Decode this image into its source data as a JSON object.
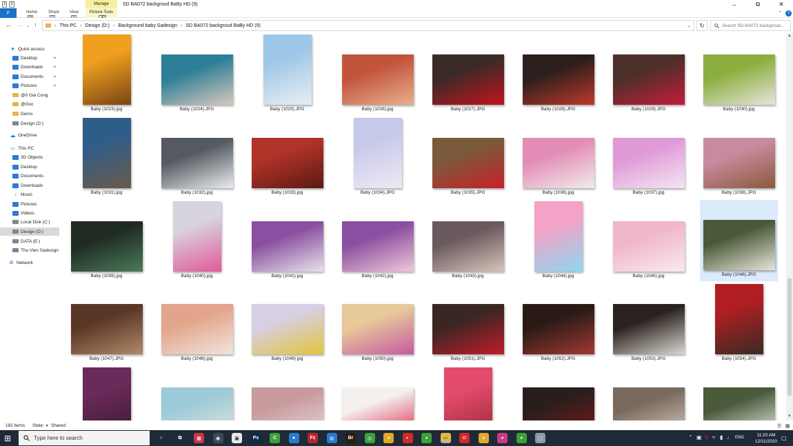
{
  "window": {
    "title": "SD BA072 backgroud BaBy HD (9)",
    "manage_tab": "Manage",
    "picture_tools": "Picture Tools",
    "file_tab": "F",
    "ribbon_tabs": [
      {
        "label": "Home",
        "key": "H"
      },
      {
        "label": "Share",
        "key": "S"
      },
      {
        "label": "View",
        "key": "V"
      },
      {
        "label": "Picture Tools",
        "key": "JP"
      }
    ],
    "qat_keys": [
      "1",
      "2"
    ]
  },
  "address": {
    "crumbs": [
      "This PC",
      "Design (D:)",
      "Background baby Sadesign",
      "SD BA072 backgroud BaBy HD (9)"
    ],
    "search_placeholder": "Search SD BA072 backgroud..."
  },
  "nav": {
    "items": [
      {
        "label": "Quick access",
        "icon": "star-icon"
      },
      {
        "label": "Desktop",
        "icon": "desktop-icon",
        "pinned": true
      },
      {
        "label": "Downloads",
        "icon": "download-icon",
        "pinned": true
      },
      {
        "label": "Documents",
        "icon": "documents-icon",
        "pinned": true
      },
      {
        "label": "Pictures",
        "icon": "pictures-icon",
        "pinned": true
      },
      {
        "label": "@0 Gia Cong",
        "icon": "folder-icon"
      },
      {
        "label": "@Goc",
        "icon": "folder-icon"
      },
      {
        "label": "Demo",
        "icon": "folder-icon"
      },
      {
        "label": "Design (D:)",
        "icon": "drive-icon"
      },
      {
        "label": "OneDrive",
        "icon": "cloud-icon"
      },
      {
        "label": "This PC",
        "icon": "computer-icon"
      },
      {
        "label": "3D Objects",
        "icon": "3d-objects-icon"
      },
      {
        "label": "Desktop",
        "icon": "desktop-icon"
      },
      {
        "label": "Documents",
        "icon": "documents-icon"
      },
      {
        "label": "Downloads",
        "icon": "download-icon"
      },
      {
        "label": "Music",
        "icon": "music-icon"
      },
      {
        "label": "Pictures",
        "icon": "pictures-icon"
      },
      {
        "label": "Videos",
        "icon": "videos-icon"
      },
      {
        "label": "Local Disk (C:)",
        "icon": "drive-icon"
      },
      {
        "label": "Design (D:)",
        "icon": "drive-icon",
        "selected": true
      },
      {
        "label": "DATA  (E:)",
        "icon": "drive-icon"
      },
      {
        "label": "Thu Vien Sadesign",
        "icon": "drive-icon"
      },
      {
        "label": "Network",
        "icon": "network-icon"
      }
    ]
  },
  "files": [
    {
      "name": "Baby (1023).jpg",
      "colors": [
        "#f0a01e",
        "#7a4414"
      ],
      "orient": "portrait"
    },
    {
      "name": "Baby (1024).JPG",
      "colors": [
        "#2c7f96",
        "#d9c8bb"
      ],
      "orient": "landscape"
    },
    {
      "name": "Baby (1025).JPG",
      "colors": [
        "#9ec7e7",
        "#e9eef2"
      ],
      "orient": "portrait"
    },
    {
      "name": "Baby (1026).jpg",
      "colors": [
        "#c3543c",
        "#e7b08e"
      ],
      "orient": "landscape"
    },
    {
      "name": "Baby (1027).JPG",
      "colors": [
        "#3a2a28",
        "#c2141c"
      ],
      "orient": "landscape"
    },
    {
      "name": "Baby (1028).JPG",
      "colors": [
        "#2a1f1c",
        "#c0382a"
      ],
      "orient": "landscape"
    },
    {
      "name": "Baby (1029).JPG",
      "colors": [
        "#4a3028",
        "#c51c3b"
      ],
      "orient": "landscape"
    },
    {
      "name": "Baby (1030).jpg",
      "colors": [
        "#8cae3e",
        "#e6e4dc"
      ],
      "orient": "landscape"
    },
    {
      "name": "Baby (1031).jpg",
      "colors": [
        "#2f5d8a",
        "#6a5a48"
      ],
      "orient": "portrait"
    },
    {
      "name": "Baby (1032).jpg",
      "colors": [
        "#555a60",
        "#e9ecf0"
      ],
      "orient": "landscape"
    },
    {
      "name": "Baby (1033).jpg",
      "colors": [
        "#b03228",
        "#5a1a14"
      ],
      "orient": "landscape"
    },
    {
      "name": "Baby (1034).JPG",
      "colors": [
        "#c7c9ea",
        "#efe9f4"
      ],
      "orient": "portrait"
    },
    {
      "name": "Baby (1035).JPG",
      "colors": [
        "#7a5a3a",
        "#c8202a"
      ],
      "orient": "landscape"
    },
    {
      "name": "Baby (1036).jpg",
      "colors": [
        "#e38cb6",
        "#f1ecea"
      ],
      "orient": "landscape"
    },
    {
      "name": "Baby (1037).jpg",
      "colors": [
        "#e09ad8",
        "#f4e6f2"
      ],
      "orient": "landscape"
    },
    {
      "name": "Baby (1038).JPG",
      "colors": [
        "#c98aa0",
        "#8a5a3a"
      ],
      "orient": "landscape"
    },
    {
      "name": "Baby (1039).jpg",
      "colors": [
        "#1e2a22",
        "#4c7a5a"
      ],
      "orient": "landscape"
    },
    {
      "name": "Baby (1040).jpg",
      "colors": [
        "#d8d4dd",
        "#e05a9a"
      ],
      "orient": "portrait"
    },
    {
      "name": "Baby (1041).jpg",
      "colors": [
        "#8a4fa0",
        "#e8e3ea"
      ],
      "orient": "landscape"
    },
    {
      "name": "Baby (1042).jpg",
      "colors": [
        "#8a4fa0",
        "#f0c8d8"
      ],
      "orient": "landscape"
    },
    {
      "name": "Baby (1043).jpg",
      "colors": [
        "#6a5a5e",
        "#d7c4bb"
      ],
      "orient": "landscape"
    },
    {
      "name": "Baby (1044).jpg",
      "colors": [
        "#f4a2c6",
        "#8fd6ef"
      ],
      "orient": "portrait"
    },
    {
      "name": "Baby (1045).jpg",
      "colors": [
        "#f0b6cc",
        "#fbe9ee"
      ],
      "orient": "landscape"
    },
    {
      "name": "Baby (1046).JPG",
      "colors": [
        "#4a5a38",
        "#e9e5da"
      ],
      "orient": "landscape",
      "selected": true
    },
    {
      "name": "Baby (1047).JPG",
      "colors": [
        "#5a3626",
        "#b08a6a"
      ],
      "orient": "landscape"
    },
    {
      "name": "Baby (1048).jpg",
      "colors": [
        "#e2a48a",
        "#f2e4dc"
      ],
      "orient": "landscape"
    },
    {
      "name": "Baby (1049).jpg",
      "colors": [
        "#d7cfe4",
        "#e3c43a"
      ],
      "orient": "landscape"
    },
    {
      "name": "Baby (1050).jpg",
      "colors": [
        "#e7c99a",
        "#c65aa0"
      ],
      "orient": "landscape"
    },
    {
      "name": "Baby (1051).JPG",
      "colors": [
        "#3a2622",
        "#c01c2a"
      ],
      "orient": "landscape"
    },
    {
      "name": "Baby (1052).JPG",
      "colors": [
        "#2a1a16",
        "#a03a32"
      ],
      "orient": "landscape"
    },
    {
      "name": "Baby (1053).JPG",
      "colors": [
        "#2a221e",
        "#dcd8d2"
      ],
      "orient": "landscape"
    },
    {
      "name": "Baby (1054).JPG",
      "colors": [
        "#b01e22",
        "#3a2a24"
      ],
      "orient": "portrait"
    },
    {
      "name": "",
      "colors": [
        "#6a2a5a",
        "#3a1a30"
      ],
      "orient": "portrait"
    },
    {
      "name": "",
      "colors": [
        "#9ccad6",
        "#e4e4e0"
      ],
      "orient": "landscape"
    },
    {
      "name": "",
      "colors": [
        "#c79a9e",
        "#e8d8d4"
      ],
      "orient": "landscape"
    },
    {
      "name": "",
      "colors": [
        "#f3f0ee",
        "#e02a4a"
      ],
      "orient": "landscape"
    },
    {
      "name": "",
      "colors": [
        "#e24b6a",
        "#9c2a3a"
      ],
      "orient": "portrait"
    },
    {
      "name": "",
      "colors": [
        "#2a1e1c",
        "#7a1a1a"
      ],
      "orient": "landscape"
    },
    {
      "name": "",
      "colors": [
        "#7a6a5e",
        "#d8ccc4"
      ],
      "orient": "landscape"
    },
    {
      "name": "",
      "colors": [
        "#4a5a3a",
        "#f0f0ee"
      ],
      "orient": "landscape"
    }
  ],
  "status": {
    "items_count": "182 items",
    "state_label": "State:",
    "state_value": "Shared"
  },
  "taskbar": {
    "search_placeholder": "Type here to search",
    "apps": [
      {
        "icon": "cortana-icon",
        "color": "#1f2a36",
        "glyph": "○"
      },
      {
        "icon": "task-view-icon",
        "color": "#1f2a36",
        "glyph": "⧉"
      },
      {
        "icon": "app-icon",
        "color": "#c8364a",
        "glyph": "▦"
      },
      {
        "icon": "app-icon",
        "color": "#3a4a5a",
        "glyph": "◉"
      },
      {
        "icon": "app-icon",
        "color": "#e7e7e7",
        "glyph": "▣"
      },
      {
        "icon": "photoshop-icon",
        "color": "#0c2a4a",
        "glyph": "Ps"
      },
      {
        "icon": "app-icon",
        "color": "#3aa13a",
        "glyph": "C"
      },
      {
        "icon": "app-icon",
        "color": "#2a7ad0",
        "glyph": "●"
      },
      {
        "icon": "filezilla-icon",
        "color": "#b8262a",
        "glyph": "Fz"
      },
      {
        "icon": "app-icon",
        "color": "#2a7ad0",
        "glyph": "◍"
      },
      {
        "icon": "bridge-icon",
        "color": "#2a1e0e",
        "glyph": "Br"
      },
      {
        "icon": "app-icon",
        "color": "#3aa13a",
        "glyph": "◎"
      },
      {
        "icon": "chrome-icon",
        "color": "#e0a82a",
        "glyph": "◕"
      },
      {
        "icon": "app-icon",
        "color": "#d02a2a",
        "glyph": "◐"
      },
      {
        "icon": "chrome-icon",
        "color": "#3aa13a",
        "glyph": "◕"
      },
      {
        "icon": "file-explorer-icon",
        "color": "#e6b64a",
        "glyph": "▭",
        "active": true
      },
      {
        "icon": "app-icon",
        "color": "#d02a2a",
        "glyph": "◘"
      },
      {
        "icon": "chrome-icon",
        "color": "#e0a82a",
        "glyph": "◕"
      },
      {
        "icon": "chrome-icon",
        "color": "#c83a8a",
        "glyph": "◕"
      },
      {
        "icon": "chrome-icon",
        "color": "#3aa13a",
        "glyph": "◕"
      },
      {
        "icon": "app-icon",
        "color": "#8a9aa6",
        "glyph": "▢"
      }
    ],
    "lang": "ENG",
    "time": "11:20 AM",
    "date": "12/11/2020"
  }
}
